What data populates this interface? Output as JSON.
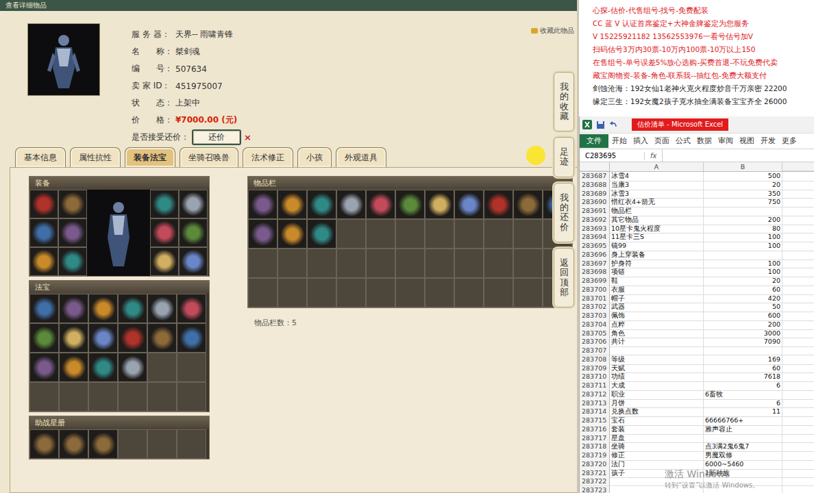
{
  "page": {
    "header": "查看详细物品",
    "favorite_link": "收藏此物品"
  },
  "item_info": {
    "fields": [
      {
        "label": "服 务 器：",
        "value": "天界-- 雨啸青锋",
        "highlight": false
      },
      {
        "label": "名　　称：",
        "value": "桀剑魂",
        "highlight": false
      },
      {
        "label": "编　　号：",
        "value": "507634",
        "highlight": false
      },
      {
        "label": "卖 家 ID：",
        "value": "451975007",
        "highlight": false
      },
      {
        "label": "状　　态：",
        "value": "上架中",
        "highlight": false
      },
      {
        "label": "价　　格：",
        "value": "¥7000.00 (元)",
        "highlight": true
      }
    ],
    "bargain": {
      "label": "是否接受还价：",
      "button": "还价",
      "close": "×"
    }
  },
  "tabs": [
    {
      "label": "基本信息",
      "selected": false
    },
    {
      "label": "属性抗性",
      "selected": false
    },
    {
      "label": "装备法宝",
      "selected": true
    },
    {
      "label": "坐骑召唤兽",
      "selected": false
    },
    {
      "label": "法术修正",
      "selected": false
    },
    {
      "label": "小孩",
      "selected": false
    },
    {
      "label": "外观道具",
      "selected": false
    }
  ],
  "equipment": {
    "title": "装备",
    "left_slots": [
      true,
      true,
      true,
      true,
      true,
      true
    ],
    "right_slots": [
      true,
      true,
      true,
      true,
      true,
      true
    ]
  },
  "fabao": {
    "title": "法宝",
    "slots": [
      true,
      true,
      true,
      true,
      true,
      true,
      true,
      true,
      true,
      true,
      true,
      true,
      true,
      true,
      true,
      true,
      false,
      false,
      false,
      false,
      false,
      false,
      false,
      false
    ]
  },
  "star_book": {
    "title": "助战星册",
    "slots": [
      true,
      true,
      true,
      false,
      false,
      false
    ]
  },
  "inventory": {
    "title": "物品栏",
    "count_label": "物品栏数：5",
    "slots": [
      true,
      true,
      true,
      true,
      true,
      true,
      true,
      true,
      true,
      true,
      true,
      true,
      true,
      true,
      false,
      false,
      false,
      false,
      false,
      false,
      false,
      false,
      false,
      false,
      false,
      false,
      false,
      false,
      false,
      false,
      false,
      false,
      false,
      false,
      false,
      false,
      false,
      false,
      false,
      false,
      false,
      false,
      false,
      false
    ]
  },
  "side_nav": [
    {
      "label": "我的收藏"
    },
    {
      "label": "足迹"
    },
    {
      "label": "我的还价"
    },
    {
      "label": "返回顶部"
    }
  ],
  "ad": {
    "lines": [
      {
        "text": "心探-估价-代售组号-找号-免费配装",
        "color": "#e0201c"
      },
      {
        "text": "CC 蓝 V 认证首席鉴定+大神金牌鉴定为您服务",
        "color": "#e0201c"
      },
      {
        "text": "V 15225921182   13562553976一看号估号加V",
        "color": "#e0201c"
      },
      {
        "text": "扫码估号3万内30票-10万内100票-10万以上150",
        "color": "#e0201c"
      },
      {
        "text": "在售组号-单号误差5%放心选购-买费首退-不玩免费代卖",
        "color": "#e0201c"
      },
      {
        "text": "藏宝阁物资-装备-角色-联系我--抽红包-免费大额支付",
        "color": "#e0201c"
      },
      {
        "text": "剑蚀沧海：192女仙1老神火克火程度炒音千万亲密 22200",
        "color": "#222222"
      },
      {
        "text": "缘定三生：192女魔2孩子克水抽全满装备宝宝齐全 26000",
        "color": "#222222"
      }
    ]
  },
  "excel": {
    "title": "估价清单 - Microsoft Excel",
    "menu": [
      {
        "label": "文件",
        "selected": true
      },
      {
        "label": "开始",
        "selected": false
      },
      {
        "label": "插入",
        "selected": false
      },
      {
        "label": "页面",
        "selected": false
      },
      {
        "label": "公式",
        "selected": false
      },
      {
        "label": "数据",
        "selected": false
      },
      {
        "label": "审阅",
        "selected": false
      },
      {
        "label": "视图",
        "selected": false
      },
      {
        "label": "开发",
        "selected": false
      },
      {
        "label": "更多",
        "selected": false
      }
    ],
    "name_box": "C283695",
    "fx": "fx",
    "columns": [
      "A",
      "B"
    ],
    "rows": [
      {
        "num": "283687",
        "a": "冰雪4",
        "b": "500",
        "kind": "number"
      },
      {
        "num": "283688",
        "a": "当康3",
        "b": "20",
        "kind": "number"
      },
      {
        "num": "283689",
        "a": "冰雪3",
        "b": "350",
        "kind": "number"
      },
      {
        "num": "283690",
        "a": "惜红衣4+箭无",
        "b": "750",
        "kind": "number"
      },
      {
        "num": "283691",
        "a": "物品栏",
        "b": "",
        "kind": "text"
      },
      {
        "num": "283692",
        "a": "其它物品",
        "b": "200",
        "kind": "number"
      },
      {
        "num": "283693",
        "a": "10星卡鬼火程度",
        "b": "80",
        "kind": "number"
      },
      {
        "num": "283694",
        "a": "11星卡三S",
        "b": "100",
        "kind": "number"
      },
      {
        "num": "283695",
        "a": "镜99",
        "b": "100",
        "kind": "number"
      },
      {
        "num": "283696",
        "a": "身上穿装备",
        "b": "",
        "kind": "text"
      },
      {
        "num": "283697",
        "a": "护身符",
        "b": "100",
        "kind": "number"
      },
      {
        "num": "283698",
        "a": "项链",
        "b": "100",
        "kind": "number"
      },
      {
        "num": "283699",
        "a": "鞋",
        "b": "20",
        "kind": "number"
      },
      {
        "num": "283700",
        "a": "衣服",
        "b": "60",
        "kind": "number"
      },
      {
        "num": "283701",
        "a": "帽子",
        "b": "420",
        "kind": "number"
      },
      {
        "num": "283702",
        "a": "武器",
        "b": "50",
        "kind": "number"
      },
      {
        "num": "283703",
        "a": "佩饰",
        "b": "600",
        "kind": "number"
      },
      {
        "num": "283704",
        "a": "点粹",
        "b": "200",
        "kind": "number"
      },
      {
        "num": "283705",
        "a": "角色",
        "b": "3000",
        "kind": "number"
      },
      {
        "num": "283706",
        "a": "共计",
        "b": "7090",
        "kind": "number"
      },
      {
        "num": "283707",
        "a": "",
        "b": "",
        "kind": "text"
      },
      {
        "num": "283708",
        "a": "等级",
        "b": "169",
        "kind": "number"
      },
      {
        "num": "283709",
        "a": "天赋",
        "b": "60",
        "kind": "number"
      },
      {
        "num": "283710",
        "a": "功绩",
        "b": "7618",
        "kind": "number"
      },
      {
        "num": "283711",
        "a": "大成",
        "b": "6",
        "kind": "number"
      },
      {
        "num": "283712",
        "a": "职业",
        "b": "6畜牧",
        "kind": "text"
      },
      {
        "num": "283713",
        "a": "月饼",
        "b": "6",
        "kind": "number"
      },
      {
        "num": "283714",
        "a": "兑换点数",
        "b": "11",
        "kind": "number"
      },
      {
        "num": "283715",
        "a": "宝石",
        "b": "66666766+",
        "kind": "text"
      },
      {
        "num": "283716",
        "a": "套装",
        "b": "雅声容止",
        "kind": "text"
      },
      {
        "num": "283717",
        "a": "星盘",
        "b": "",
        "kind": "text"
      },
      {
        "num": "283718",
        "a": "坐骑",
        "b": "点3满2鬼6鬼7",
        "kind": "text"
      },
      {
        "num": "283719",
        "a": "修正",
        "b": "男魔双修",
        "kind": "text"
      },
      {
        "num": "283720",
        "a": "法门",
        "b": "6000~5460",
        "kind": "text"
      },
      {
        "num": "283721",
        "a": "孩子",
        "b": "1新种族",
        "kind": "text"
      },
      {
        "num": "283722",
        "a": "",
        "b": "",
        "kind": "text"
      },
      {
        "num": "283723",
        "a": "",
        "b": "",
        "kind": "text"
      }
    ]
  },
  "watermark": {
    "title": "激活 Windows",
    "subtitle": "转到“设置”以激活 Windows。"
  }
}
